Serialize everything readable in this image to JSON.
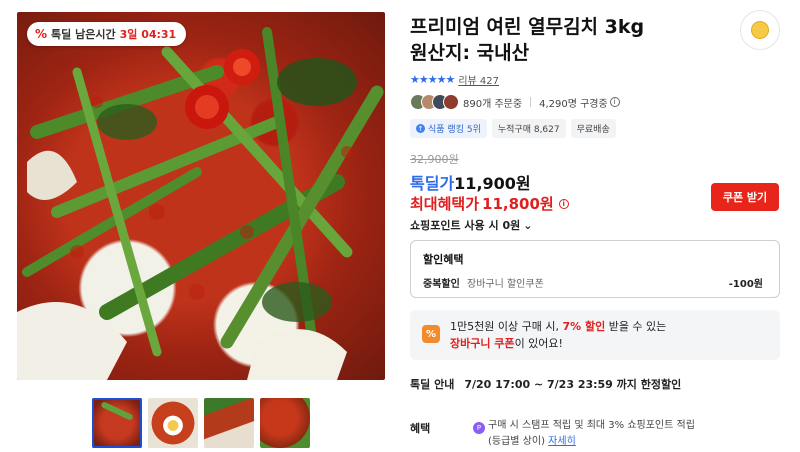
{
  "timer_badge": {
    "prefix": "톡딜 남은시간",
    "remaining": "3일 04:31",
    "icon": "percent-icon"
  },
  "gallery": {
    "thumbnail_count": 4,
    "active_index": 0
  },
  "product": {
    "title_line1": "프리미엄 여린 열무김치 3kg",
    "title_line2": "원산지: 국내산"
  },
  "rating": {
    "stars": "★★★★★",
    "review_label": "리뷰 427"
  },
  "buyers": {
    "orders": "890개 주문중",
    "subscribers": "4,290명 구경중"
  },
  "tags": {
    "rank": "식품 랭킹 5위",
    "cumulative": "누적구매 8,627",
    "shipping": "무료배송"
  },
  "price": {
    "original": "32,900원",
    "deal_label": "톡딜가",
    "deal_value": "11,900원",
    "max_label": "최대혜택가",
    "max_value": "11,800원",
    "coupon_button": "쿠폰 받기",
    "points": "쇼핑포인트 사용 시 0원"
  },
  "discount": {
    "heading": "할인혜택",
    "row_title": "중복할인",
    "row_sub": "장바구니 할인쿠폰",
    "row_amount": "-100원"
  },
  "promo": {
    "icon_text": "%",
    "line1_a": "1만5천원 이상 구매 시, ",
    "line1_highlight": "7% 할인",
    "line1_b": " 받을 수 있는",
    "line2_highlight": "장바구니 쿠폰",
    "line2_b": "이 있어요!"
  },
  "deal_info": {
    "label": "톡딜 안내",
    "period": "7/20 17:00 ~ 7/23 23:59 까지 한정할인"
  },
  "benefit": {
    "label": "혜택",
    "line1": "구매 시 스탬프 적립 및 최대 3% 쇼핑포인트 적립",
    "line2": "(등급별 상이)",
    "more_link": "자세히"
  },
  "colors": {
    "accent_blue": "#2e6be6",
    "accent_red": "#e02020",
    "coupon_red": "#e8251b"
  }
}
